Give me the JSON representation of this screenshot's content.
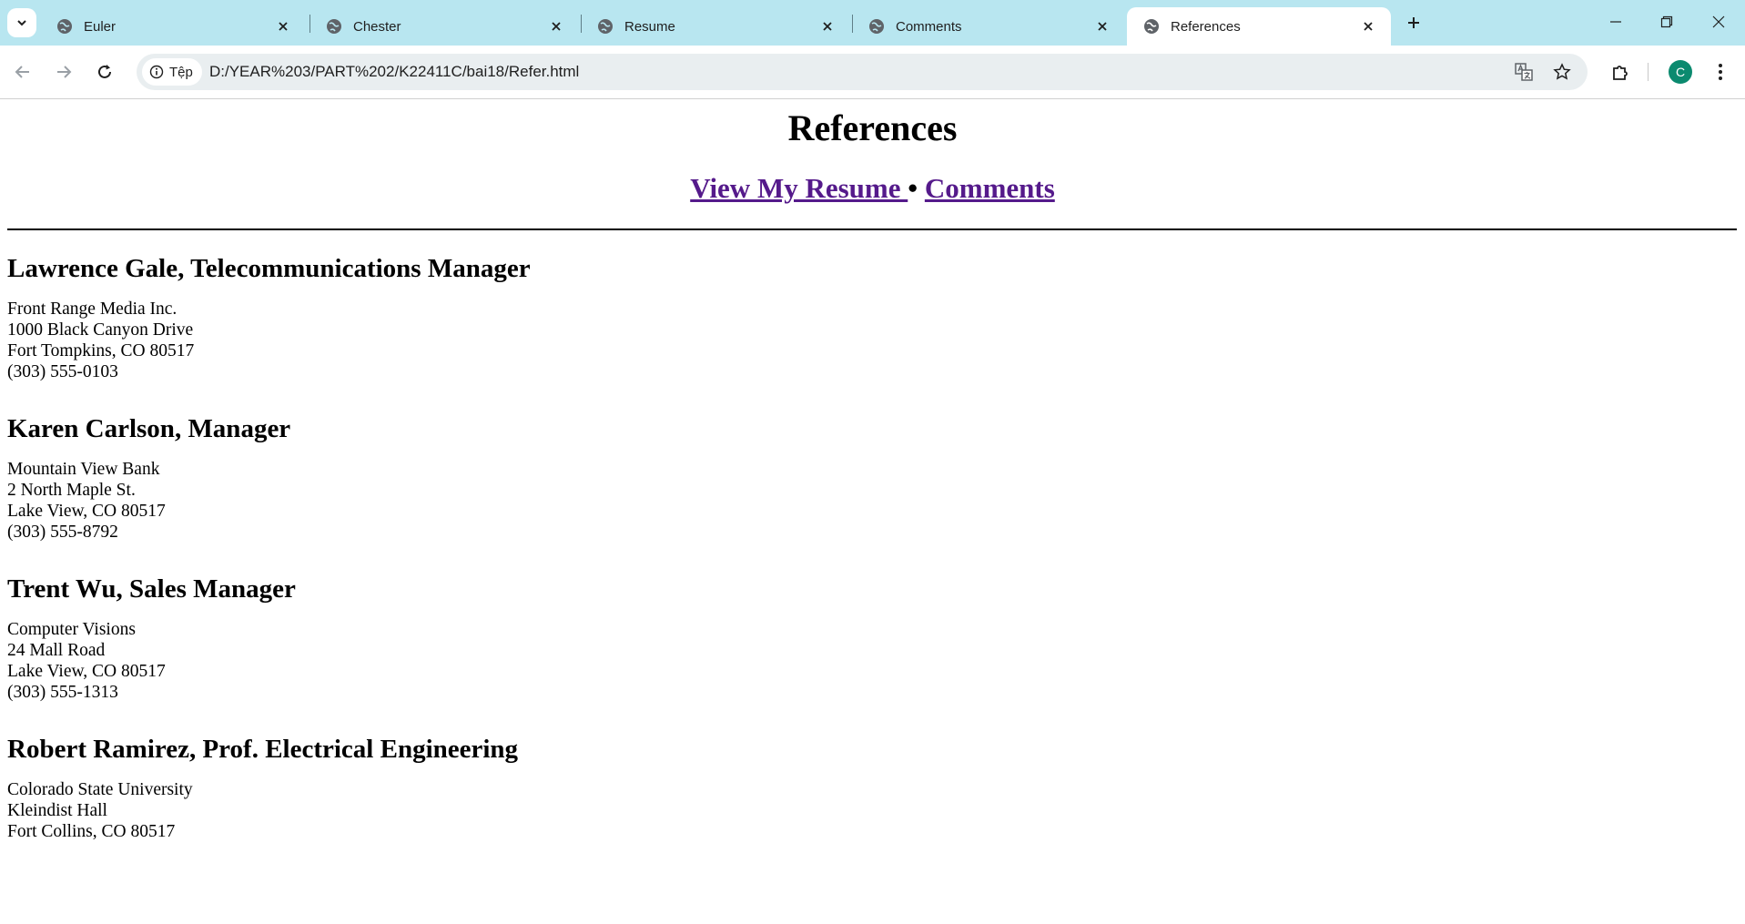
{
  "browser": {
    "tabs": [
      {
        "title": "Euler"
      },
      {
        "title": "Chester"
      },
      {
        "title": "Resume"
      },
      {
        "title": "Comments"
      },
      {
        "title": "References",
        "active": true
      }
    ],
    "site_info_label": "Tệp",
    "url": "D:/YEAR%203/PART%202/K22411C/bai18/Refer.html",
    "profile_initial": "C",
    "accent_color": "#b8e6f0",
    "avatar_color": "#0b8a6f"
  },
  "page": {
    "title": "References",
    "nav": {
      "resume_link": "View My Resume ",
      "separator": " • ",
      "comments_link": "Comments"
    },
    "link_color": "#551a8b",
    "references": [
      {
        "heading": "Lawrence Gale, Telecommunications Manager",
        "lines": [
          "Front Range Media Inc.",
          "1000 Black Canyon Drive",
          "Fort Tompkins, CO 80517",
          "(303) 555-0103"
        ]
      },
      {
        "heading": "Karen Carlson, Manager",
        "lines": [
          "Mountain View Bank",
          "2 North Maple St.",
          "Lake View, CO 80517",
          "(303) 555-8792"
        ]
      },
      {
        "heading": "Trent Wu, Sales Manager",
        "lines": [
          "Computer Visions",
          "24 Mall Road",
          "Lake View, CO 80517",
          "(303) 555-1313"
        ]
      },
      {
        "heading": "Robert Ramirez, Prof. Electrical Engineering",
        "lines": [
          "Colorado State University",
          "Kleindist Hall",
          "Fort Collins, CO 80517"
        ]
      }
    ]
  }
}
